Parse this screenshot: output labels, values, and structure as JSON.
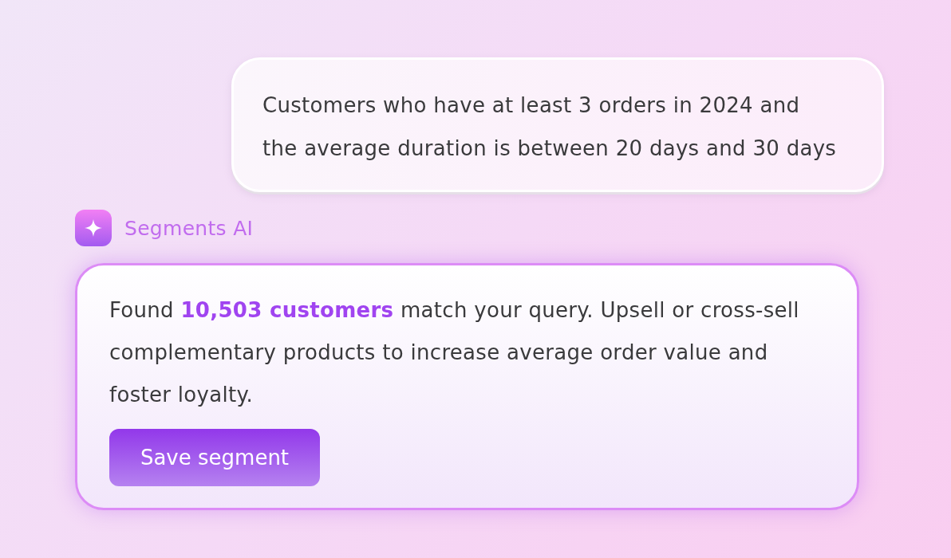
{
  "user_message": {
    "text": "Customers who have at least 3 orders in 2024 and the average duration is between 20 days and 30 days"
  },
  "assistant": {
    "name": "Segments AI",
    "message": "Found **10,503 customers** match your query. Upsell or cross-sell complementary products to increase average order value and foster loyalty.",
    "button": {
      "label": "Save segment"
    }
  }
}
